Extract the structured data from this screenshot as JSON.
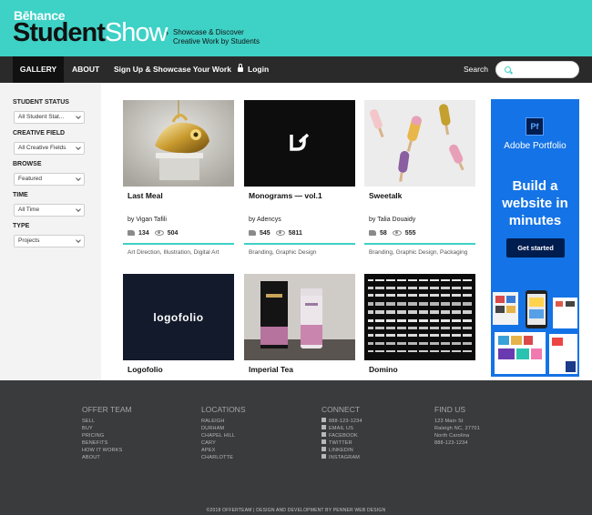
{
  "header": {
    "behance": "Bēhance",
    "brand_student": "Student",
    "brand_show": "Show",
    "tagline_line1": "Showcase & Discover",
    "tagline_line2": "Creative Work by Students"
  },
  "nav": {
    "gallery": "GALLERY",
    "about": "ABOUT",
    "signup": "Sign Up & Showcase Your Work",
    "login": "Login",
    "search_label": "Search",
    "search_value": ""
  },
  "filters": [
    {
      "label": "STUDENT STATUS",
      "value": "All Student Stat..."
    },
    {
      "label": "CREATIVE FIELD",
      "value": "All Creative Fields"
    },
    {
      "label": "BROWSE",
      "value": "Featured"
    },
    {
      "label": "TIME",
      "value": "All Time"
    },
    {
      "label": "TYPE",
      "value": "Projects"
    }
  ],
  "cards": [
    {
      "title": "Last Meal",
      "author": "by Vigan Tafili",
      "likes": "134",
      "views": "504",
      "tags": "Art Direction, Illustration, Digital Art"
    },
    {
      "title": "Monograms — vol.1",
      "author": "by Adencys",
      "likes": "545",
      "views": "5811",
      "tags": "Branding, Graphic Design"
    },
    {
      "title": "Sweetalk",
      "author": "by Talia Douaidy",
      "likes": "58",
      "views": "555",
      "tags": "Branding, Graphic Design, Packaging"
    },
    {
      "title": "Logofolio",
      "thumb_text": "logofolio"
    },
    {
      "title": "Imperial Tea"
    },
    {
      "title": "Domino"
    }
  ],
  "ad": {
    "icon_text": "Pf",
    "brand": "Adobe Portfolio",
    "headline": "Build a website in minutes",
    "cta": "Get started"
  },
  "footer": {
    "columns": [
      {
        "title": "OFFER TEAM",
        "items": [
          "SELL",
          "BUY",
          "PRICING",
          "BENEFITS",
          "HOW IT WORKS",
          "ABOUT"
        ]
      },
      {
        "title": "LOCATIONS",
        "items": [
          "RALEIGH",
          "DURHAM",
          "CHAPEL HILL",
          "CARY",
          "APEX",
          "CHARLOTTE"
        ]
      },
      {
        "title": "CONNECT",
        "items": [
          "888-123-1234",
          "EMAIL US",
          "FACEBOOK",
          "TWITTER",
          "LINKEDIN",
          "INSTAGRAM"
        ]
      },
      {
        "title": "FIND US",
        "items": [
          "123 Main St",
          "Raleigh NC, 27701",
          "North Carolina",
          "888-123-1234"
        ]
      }
    ],
    "copyright": "©2018 OFFERTEAM | DESIGN AND DEVELOPMENT BY PENNER WEB DESIGN"
  }
}
